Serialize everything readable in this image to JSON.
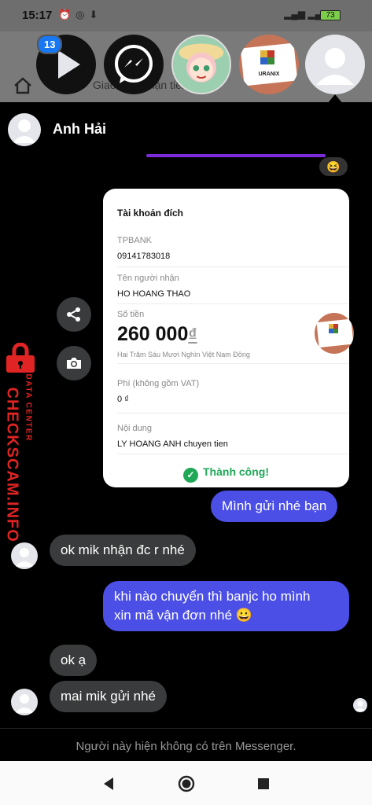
{
  "status_bar": {
    "time": "15:17",
    "battery": "73"
  },
  "background_app": {
    "partial_text": "Giao dịch nhận tiền ho-"
  },
  "chat_heads": {
    "badge_count": "13",
    "uranix_label": "URANIX"
  },
  "chat": {
    "contact_name": "Anh Hải",
    "reaction": "😆",
    "receipt": {
      "title": "Tài khoản đích",
      "bank": "TPBANK",
      "account_number": "09141783018",
      "recipient_label": "Tên người nhận",
      "recipient_name": "HO HOANG THAO",
      "amount_label": "Số tiền",
      "amount": "260 000",
      "currency": "₫",
      "amount_words": "Hai Trăm Sáu Mươi Nghìn Việt Nam Đồng",
      "fee_label": "Phí (không gồm VAT)",
      "fee_value": "0 ₫",
      "content_label": "Nội dung",
      "content_value": "LY HOANG ANH chuyen tien",
      "status": "Thành công!"
    },
    "messages": [
      {
        "text": "Mình gửi nhé bạn"
      },
      {
        "text": "ok mik nhận đc r nhé"
      },
      {
        "line1": "khi nào chuyển thì banjc ho mình",
        "line2": "xin mã vận đơn nhé 😀"
      },
      {
        "text": "ok ạ"
      },
      {
        "text": "mai mik gửi nhé"
      }
    ],
    "unavailable_note": "Người này hiện không có trên Messenger."
  },
  "watermark": {
    "main": "CHECKSCAM.INFO",
    "sub": "DATA CENTER"
  },
  "colors": {
    "outgoing_bubble": "#4b4fe6",
    "incoming_bubble": "#3a3b3c",
    "success": "#1fa957",
    "watermark": "#e02424"
  }
}
